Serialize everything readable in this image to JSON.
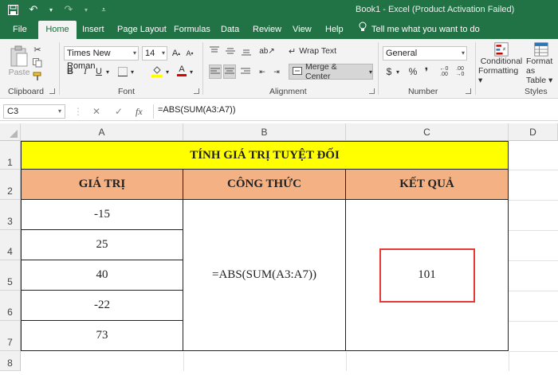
{
  "window": {
    "title": "Book1  -  Excel (Product Activation Failed)"
  },
  "ribbon_tabs": [
    {
      "label": "File"
    },
    {
      "label": "Home"
    },
    {
      "label": "Insert"
    },
    {
      "label": "Page Layout"
    },
    {
      "label": "Formulas"
    },
    {
      "label": "Data"
    },
    {
      "label": "Review"
    },
    {
      "label": "View"
    },
    {
      "label": "Help"
    }
  ],
  "tell_me": "Tell me what you want to do",
  "clipboard": {
    "paste_label": "Paste",
    "group_label": "Clipboard"
  },
  "font": {
    "name": "Times New Roman",
    "size": "14",
    "group_label": "Font"
  },
  "alignment": {
    "wrap_text": "Wrap Text",
    "merge_center": "Merge & Center",
    "group_label": "Alignment"
  },
  "number": {
    "format": "General",
    "group_label": "Number",
    "currency": "$",
    "percent": "%"
  },
  "styles": {
    "conditional": "Conditional",
    "formatting": "Formatting",
    "format_as": "Format as",
    "table": "Table",
    "group_label": "Styles"
  },
  "formula_bar": {
    "cell_ref": "C3",
    "formula": "=ABS(SUM(A3:A7))"
  },
  "columns": [
    "A",
    "B",
    "C",
    "D"
  ],
  "rows": [
    "1",
    "2",
    "3",
    "4",
    "5",
    "6",
    "7",
    "8"
  ],
  "sheet": {
    "title": "TÍNH GIÁ TRỊ TUYỆT ĐỐI",
    "headers": [
      "GIÁ TRỊ",
      "CÔNG THỨC",
      "KẾT QUẢ"
    ],
    "values": [
      "-15",
      "25",
      "40",
      "-22",
      "73"
    ],
    "formula_text": "=ABS(SUM(A3:A7))",
    "result": "101"
  },
  "colors": {
    "excel_green": "#217346",
    "title_fill": "#ffff00",
    "header_fill": "#f4b183",
    "highlight_box": "#e53935"
  }
}
